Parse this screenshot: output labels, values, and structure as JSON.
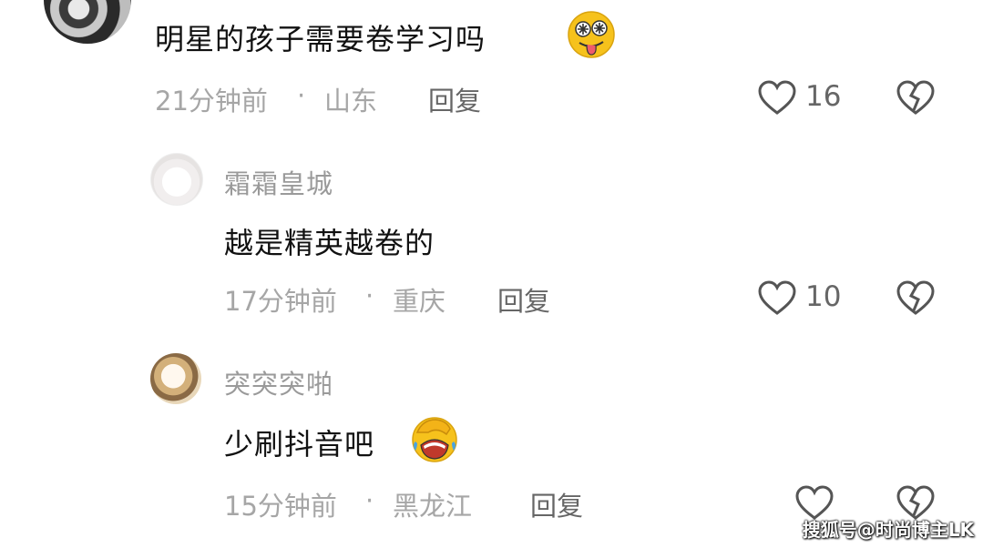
{
  "comments": [
    {
      "text": "明星的孩子需要卷学习吗",
      "emoji": "drooling-star-eyes-emoji",
      "time": "21分钟前",
      "dot": "·",
      "location": "山东",
      "reply": "回复",
      "likes": "16"
    },
    {
      "user": "霜霜皇城",
      "avatar": "white-cat-avatar",
      "text": "越是精英越卷的",
      "time": "17分钟前",
      "dot": "·",
      "location": "重庆",
      "reply": "回复",
      "likes": "10"
    },
    {
      "user": "突突突啪",
      "avatar": "tabby-cat-avatar",
      "text": "少刷抖音吧",
      "emoji": "facepalm-laughing-emoji",
      "time": "15分钟前",
      "dot": "·",
      "location": "黑龙江",
      "reply": "回复",
      "likes": ""
    }
  ],
  "watermark": "搜狐号@时尚博主LK",
  "colors": {
    "text": "#111111",
    "meta": "#a6a6a6",
    "emoji": "#f6c21c"
  }
}
